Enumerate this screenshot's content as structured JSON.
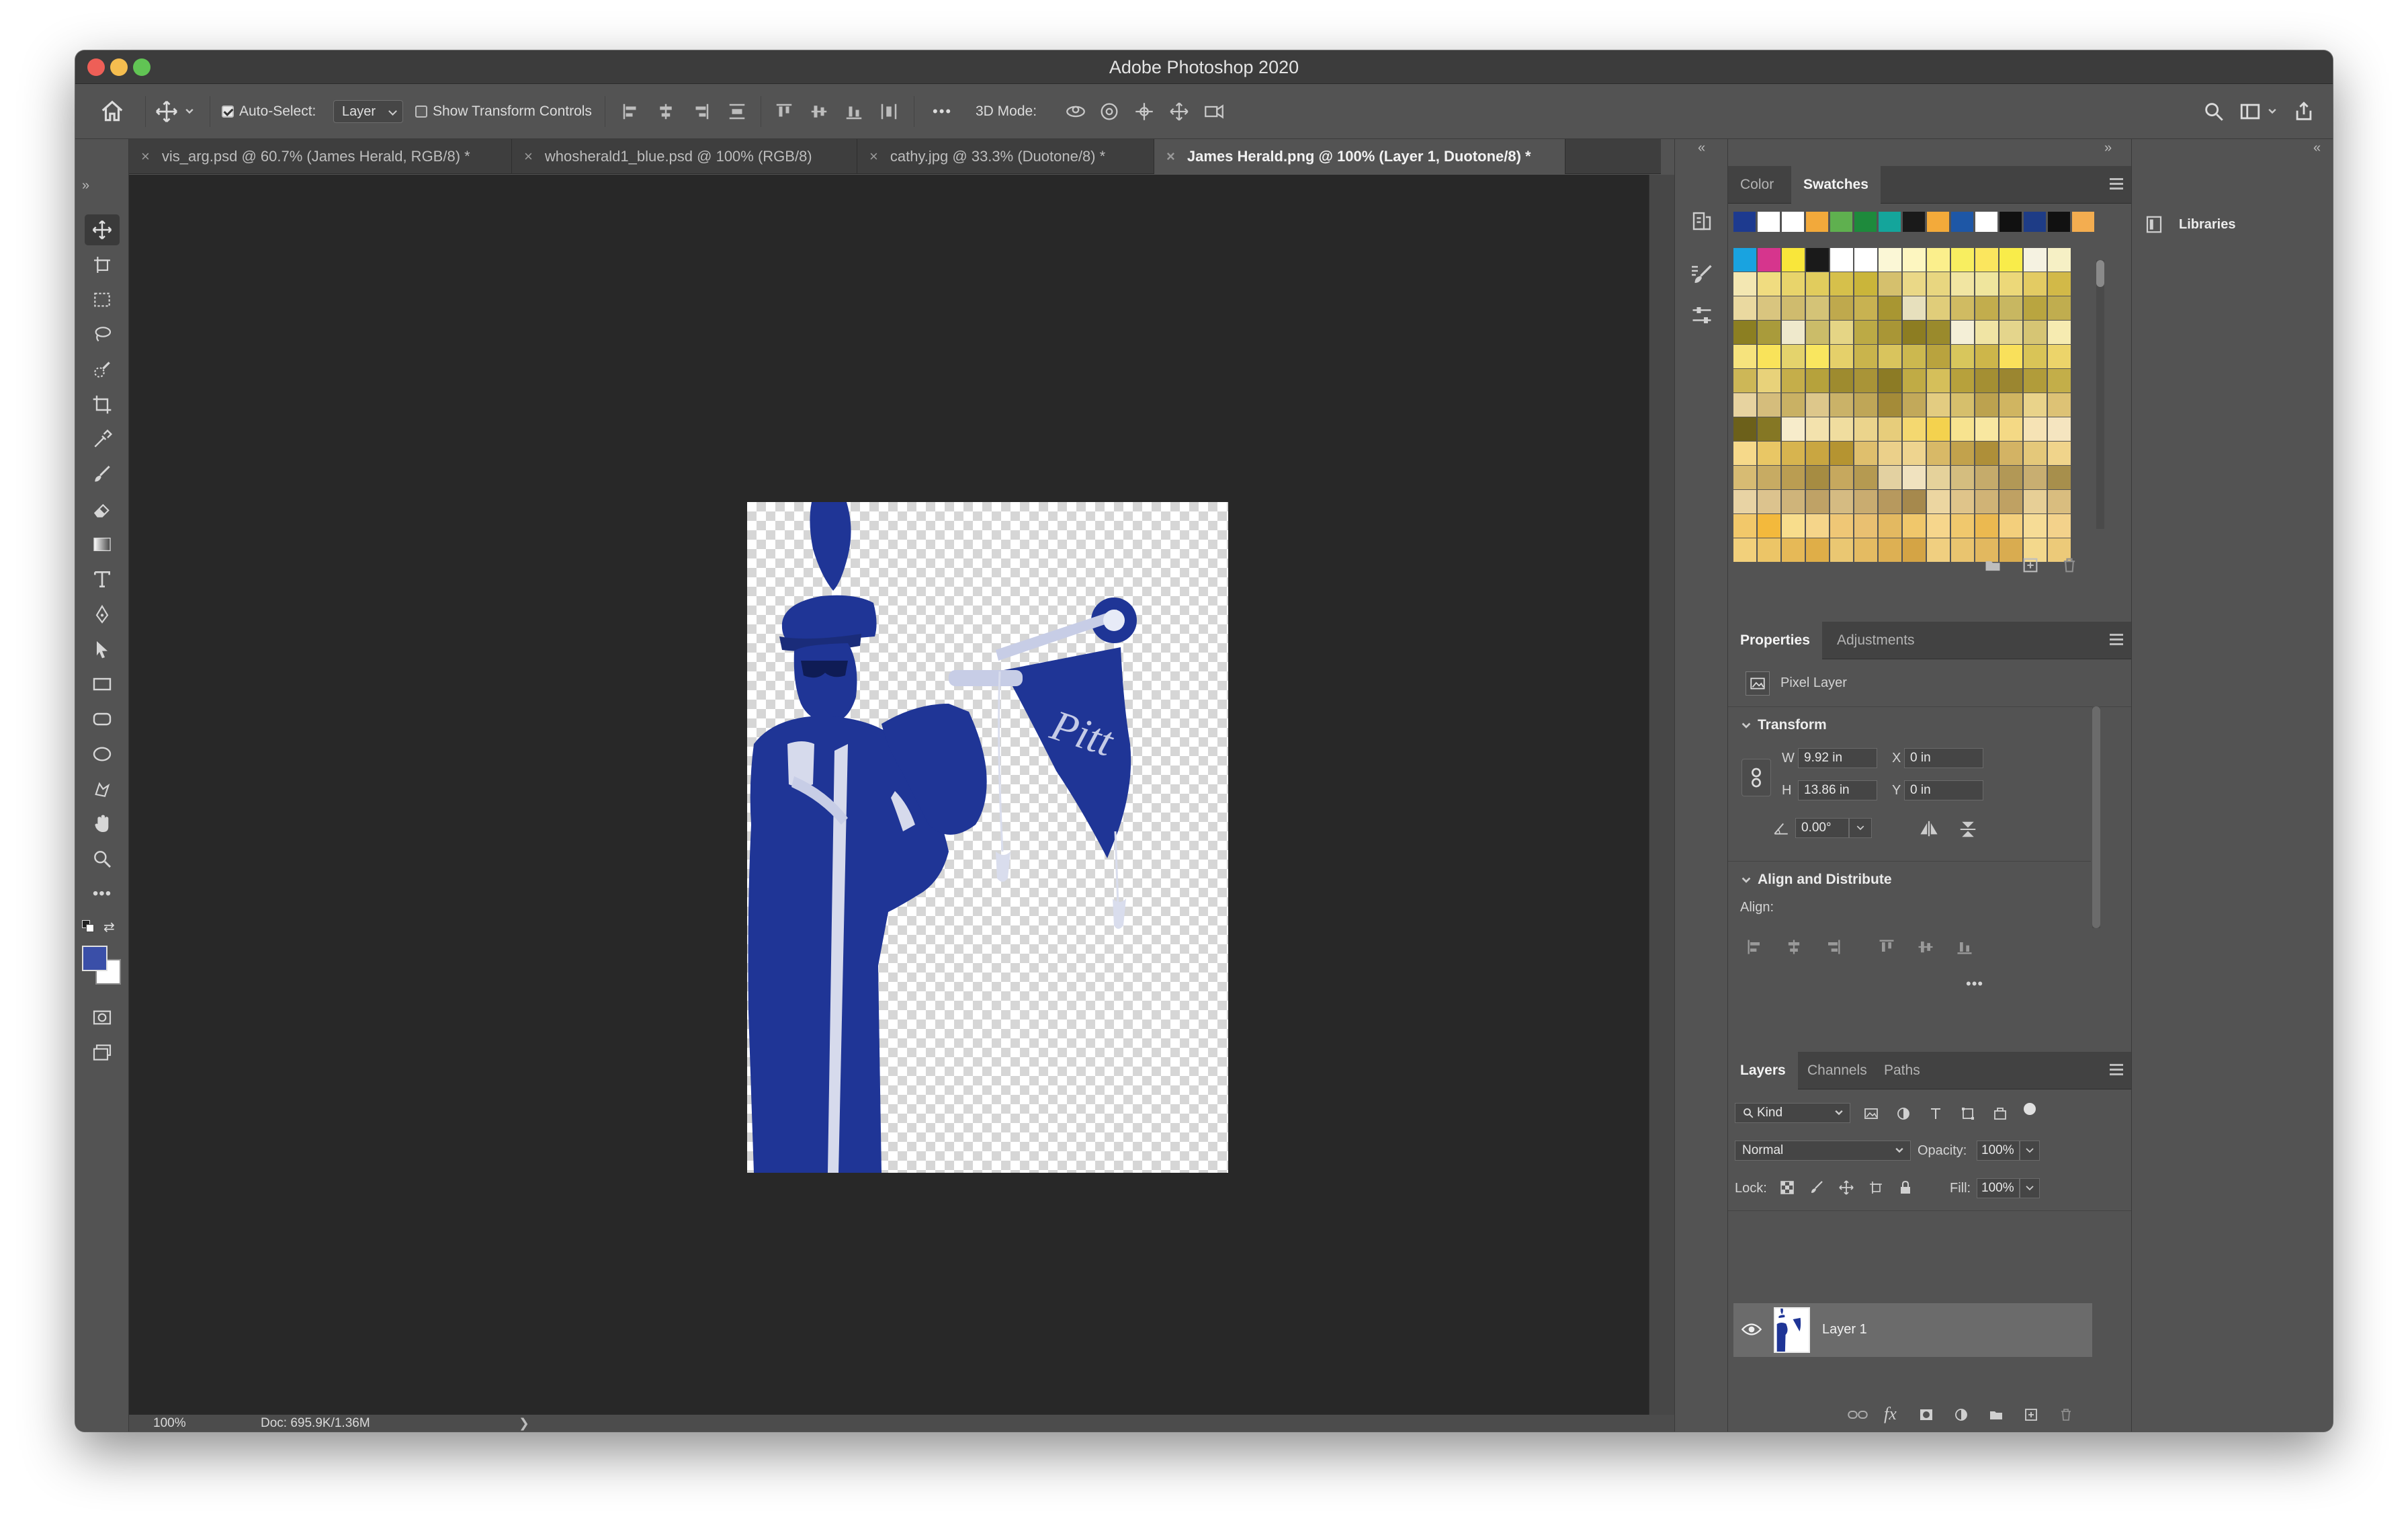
{
  "window": {
    "title": "Adobe Photoshop 2020"
  },
  "options_bar": {
    "auto_select_label": "Auto-Select:",
    "auto_select_value": "Layer",
    "show_transform_label": "Show Transform Controls",
    "mode_3d_label": "3D Mode:",
    "more_label": "•••"
  },
  "tabs": [
    {
      "label": "vis_arg.psd @ 60.7% (James Herald, RGB/8) *",
      "active": false
    },
    {
      "label": "whosherald1_blue.psd @ 100% (RGB/8)",
      "active": false
    },
    {
      "label": "cathy.jpg @ 33.3% (Duotone/8) *",
      "active": false
    },
    {
      "label": "James Herald.png @ 100% (Layer 1, Duotone/8) *",
      "active": true
    }
  ],
  "status_bar": {
    "zoom": "100%",
    "doc": "Doc: 695.9K/1.36M",
    "arrow": "❯"
  },
  "colors": {
    "foreground": "#3a4fa8",
    "background": "#ffffff",
    "duotone": "#1f3596"
  },
  "swatches_panel": {
    "tabs": [
      "Color",
      "Swatches"
    ],
    "active_tab": "Swatches",
    "top_row": [
      "#1d3a8f",
      "#ffffff",
      "#ffffff",
      "#f2a93b",
      "#5fb04f",
      "#1e8a3c",
      "#14a59b",
      "#1a1a1a",
      "#f3aa3a",
      "#1e57a6",
      "#ffffff",
      "#111111",
      "#1e3c86",
      "#111111",
      "#f3ad50"
    ],
    "grid_rows": [
      [
        "#19a3e0",
        "#d6358d",
        "#f9e63a",
        "#1a1a1a",
        "#ffffff",
        "#ffffff",
        "#fbf7d6",
        "#fdf6c0",
        "#fbef8c",
        "#f8ee60",
        "#fbe65e",
        "#f9ec4a",
        "#f5f2e1",
        "#f6f0c5"
      ],
      [
        "#f3e7b2",
        "#f0dc80",
        "#e8d46b",
        "#e1cc5d",
        "#d6c04b",
        "#cab53a",
        "#d5c06d",
        "#ead887",
        "#e8d680",
        "#f1e5a2",
        "#efe59d",
        "#ecd879",
        "#e3cb63",
        "#d2b948"
      ],
      [
        "#ead9a0",
        "#d9c57f",
        "#cfbb6e",
        "#d4c377",
        "#bfa94d",
        "#c8b251",
        "#a89632",
        "#e7e0bd",
        "#e0cd7a",
        "#d0bb62",
        "#c2ad4d",
        "#c8b761",
        "#b9a540",
        "#c0ad4f"
      ],
      [
        "#8c7f22",
        "#a99b3b",
        "#efe9cc",
        "#cbbc69",
        "#e5d585",
        "#bcaa45",
        "#a99636",
        "#8d7d22",
        "#9a8a2c",
        "#f4efd7",
        "#f0e4a4",
        "#e4d58c",
        "#d6c574",
        "#f6ebb1"
      ],
      [
        "#f6e37d",
        "#f9e35a",
        "#e4d36c",
        "#f9e65f",
        "#e5d06a",
        "#c9b44c",
        "#d9c45d",
        "#ccb84f",
        "#b9a33e",
        "#d8c65c",
        "#cdb64a",
        "#f9e05b",
        "#d9c457",
        "#ecd46a"
      ],
      [
        "#cdb757",
        "#e8d27a",
        "#c5ae4a",
        "#b6a23c",
        "#9e8b2f",
        "#a99437",
        "#8c7b25",
        "#c0ab45",
        "#d5bf5a",
        "#b7a13c",
        "#a48f33",
        "#9b8630",
        "#b19c3a",
        "#c3ae49"
      ],
      [
        "#e7d3a0",
        "#d5bd7c",
        "#c9b164",
        "#ddc78b",
        "#cab268",
        "#bfa657",
        "#a48b38",
        "#c2a95a",
        "#e3cc81",
        "#d6bf6c",
        "#bca24f",
        "#d0b561",
        "#e9d38a",
        "#ddc275"
      ],
      [
        "#6c601a",
        "#857724",
        "#f7eccb",
        "#f3e2ad",
        "#f0dd9f",
        "#ebd48c",
        "#e7cd7b",
        "#f4d870",
        "#f4d24e",
        "#f7e38f",
        "#f8e7a0",
        "#f4d985",
        "#f6e3b5",
        "#f5e5c0"
      ],
      [
        "#f6d98a",
        "#e9c765",
        "#d7b44f",
        "#c9a641",
        "#b59431",
        "#dfbf6d",
        "#ebd08a",
        "#eed48f",
        "#d8b967",
        "#c2a24c",
        "#ae8f39",
        "#d3b364",
        "#e4c87a",
        "#f0d48b"
      ],
      [
        "#d7bb73",
        "#c7ab63",
        "#ba9d52",
        "#a68c42",
        "#c6a85e",
        "#b59a51",
        "#e3d1a1",
        "#f0e2bf",
        "#e5d29b",
        "#d4bd7f",
        "#c5ab6b",
        "#b29856",
        "#c8ae71",
        "#a78f4c"
      ],
      [
        "#e8d3a4",
        "#dcc38e",
        "#cfb47a",
        "#bfa266",
        "#d5bb82",
        "#c9ac70",
        "#b7995e",
        "#a6894d",
        "#ecd6a1",
        "#dfc48a",
        "#d0b376",
        "#bfa163",
        "#e7cf96",
        "#d9bd7f"
      ],
      [
        "#f2c86a",
        "#f3b93c",
        "#f8dd8c",
        "#f5d58a",
        "#efc776",
        "#e9c071",
        "#e3b961",
        "#f0c76b",
        "#f6d68c",
        "#f0c86d",
        "#ebb950",
        "#f3cf7c",
        "#f6dc96",
        "#f3d28b"
      ],
      [
        "#f2d07b",
        "#ecc567",
        "#e6b957",
        "#dfae48",
        "#eac772",
        "#e4bb62",
        "#ddb053",
        "#d4a445",
        "#f0cf80",
        "#e9c46f",
        "#e2b85f",
        "#d9ac50",
        "#f3d88c",
        "#ecca79"
      ]
    ]
  },
  "properties_panel": {
    "tabs": [
      "Properties",
      "Adjustments"
    ],
    "active_tab": "Properties",
    "layer_type": "Pixel Layer",
    "transform_header": "Transform",
    "w_label": "W",
    "w_value": "9.92 in",
    "h_label": "H",
    "h_value": "13.86 in",
    "x_label": "X",
    "x_value": "0 in",
    "y_label": "Y",
    "y_value": "0 in",
    "angle_value": "0.00°",
    "align_header": "Align and Distribute",
    "align_label": "Align:",
    "more_label": "•••"
  },
  "layers_panel": {
    "tabs": [
      "Layers",
      "Channels",
      "Paths"
    ],
    "active_tab": "Layers",
    "filter_label": "Kind",
    "blend_mode": "Normal",
    "opacity_label": "Opacity:",
    "opacity_value": "100%",
    "lock_label": "Lock:",
    "fill_label": "Fill:",
    "fill_value": "100%",
    "layers": [
      {
        "name": "Layer 1",
        "visible": true,
        "selected": true
      }
    ]
  },
  "libraries_panel": {
    "label": "Libraries"
  }
}
